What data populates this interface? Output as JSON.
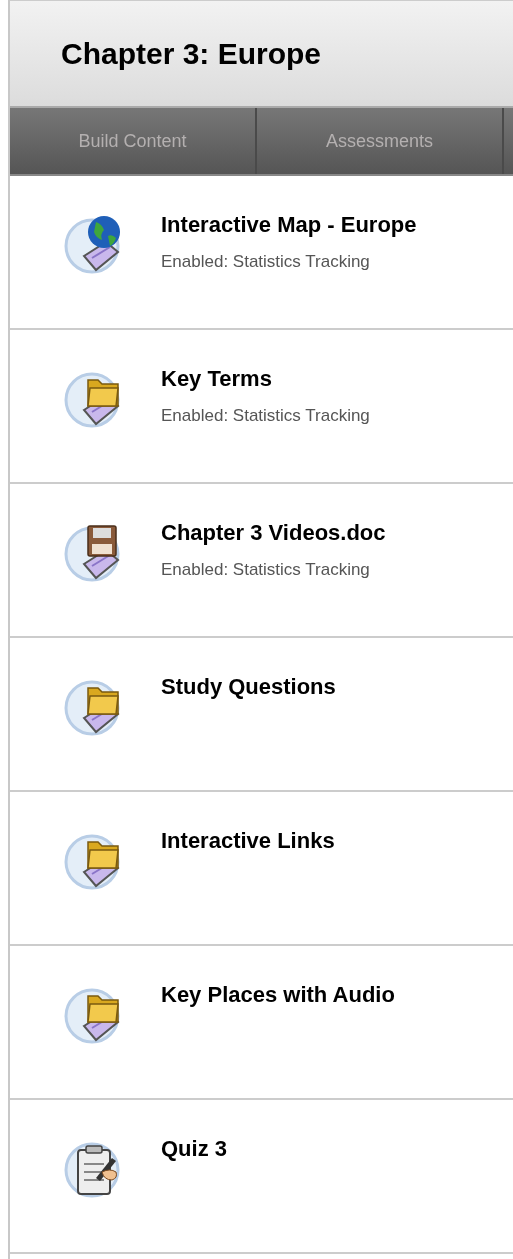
{
  "header": {
    "title": "Chapter 3: Europe"
  },
  "toolbar": {
    "tabs": [
      {
        "label": "Build Content"
      },
      {
        "label": "Assessments"
      }
    ]
  },
  "items": [
    {
      "kind": "link",
      "title": "Interactive Map - Europe",
      "detail": "Enabled:  Statistics Tracking"
    },
    {
      "kind": "folder",
      "title": "Key Terms",
      "detail": "Enabled:  Statistics Tracking"
    },
    {
      "kind": "file",
      "title": "Chapter 3 Videos.doc",
      "detail": "Enabled:  Statistics Tracking"
    },
    {
      "kind": "folder",
      "title": "Study Questions"
    },
    {
      "kind": "folder",
      "title": "Interactive Links"
    },
    {
      "kind": "folder",
      "title": "Key Places with Audio"
    },
    {
      "kind": "test",
      "title": "Quiz 3"
    }
  ]
}
